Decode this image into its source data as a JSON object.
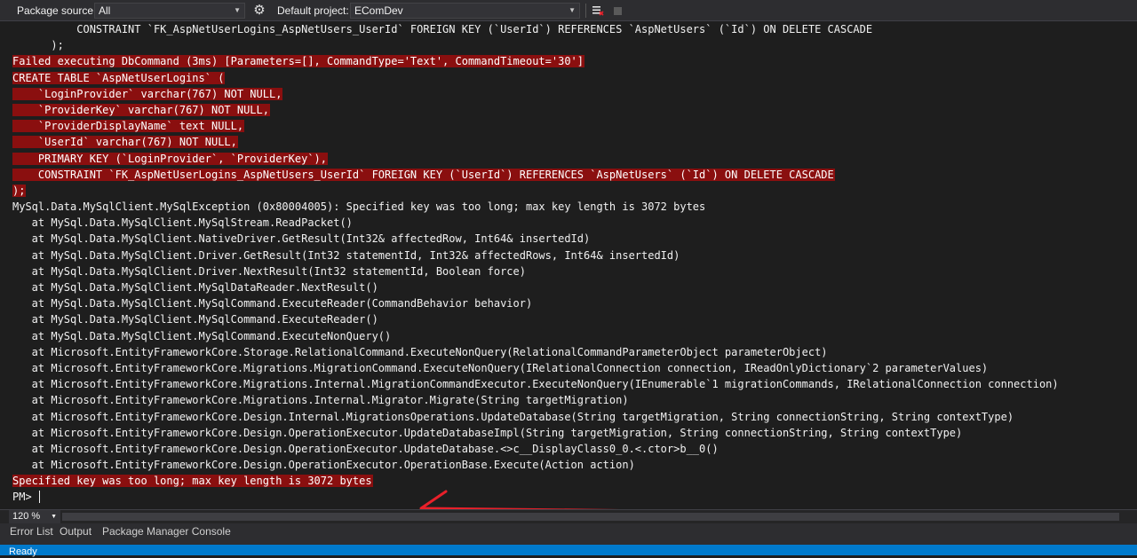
{
  "toolbar": {
    "package_source_label": "Package source:",
    "package_source_value": "All",
    "default_project_label": "Default project:",
    "default_project_value": "EComDev"
  },
  "console": {
    "lines": [
      {
        "text": "          CONSTRAINT `FK_AspNetUserLogins_AspNetUsers_UserId` FOREIGN KEY (`UserId`) REFERENCES `AspNetUsers` (`Id`) ON DELETE CASCADE",
        "error": false
      },
      {
        "text": "      );",
        "error": false
      },
      {
        "text": "Failed executing DbCommand (3ms) [Parameters=[], CommandType='Text', CommandTimeout='30']",
        "error": true
      },
      {
        "text": "CREATE TABLE `AspNetUserLogins` (",
        "error": true
      },
      {
        "text": "    `LoginProvider` varchar(767) NOT NULL,",
        "error": true
      },
      {
        "text": "    `ProviderKey` varchar(767) NOT NULL,",
        "error": true
      },
      {
        "text": "    `ProviderDisplayName` text NULL,",
        "error": true
      },
      {
        "text": "    `UserId` varchar(767) NOT NULL,",
        "error": true
      },
      {
        "text": "    PRIMARY KEY (`LoginProvider`, `ProviderKey`),",
        "error": true
      },
      {
        "text": "    CONSTRAINT `FK_AspNetUserLogins_AspNetUsers_UserId` FOREIGN KEY (`UserId`) REFERENCES `AspNetUsers` (`Id`) ON DELETE CASCADE",
        "error": true
      },
      {
        "text": ");",
        "error": true
      },
      {
        "text": "MySql.Data.MySqlClient.MySqlException (0x80004005): Specified key was too long; max key length is 3072 bytes",
        "error": false
      },
      {
        "text": "   at MySql.Data.MySqlClient.MySqlStream.ReadPacket()",
        "error": false
      },
      {
        "text": "   at MySql.Data.MySqlClient.NativeDriver.GetResult(Int32& affectedRow, Int64& insertedId)",
        "error": false
      },
      {
        "text": "   at MySql.Data.MySqlClient.Driver.GetResult(Int32 statementId, Int32& affectedRows, Int64& insertedId)",
        "error": false
      },
      {
        "text": "   at MySql.Data.MySqlClient.Driver.NextResult(Int32 statementId, Boolean force)",
        "error": false
      },
      {
        "text": "   at MySql.Data.MySqlClient.MySqlDataReader.NextResult()",
        "error": false
      },
      {
        "text": "   at MySql.Data.MySqlClient.MySqlCommand.ExecuteReader(CommandBehavior behavior)",
        "error": false
      },
      {
        "text": "   at MySql.Data.MySqlClient.MySqlCommand.ExecuteReader()",
        "error": false
      },
      {
        "text": "   at MySql.Data.MySqlClient.MySqlCommand.ExecuteNonQuery()",
        "error": false
      },
      {
        "text": "   at Microsoft.EntityFrameworkCore.Storage.RelationalCommand.ExecuteNonQuery(RelationalCommandParameterObject parameterObject)",
        "error": false
      },
      {
        "text": "   at Microsoft.EntityFrameworkCore.Migrations.MigrationCommand.ExecuteNonQuery(IRelationalConnection connection, IReadOnlyDictionary`2 parameterValues)",
        "error": false
      },
      {
        "text": "   at Microsoft.EntityFrameworkCore.Migrations.Internal.MigrationCommandExecutor.ExecuteNonQuery(IEnumerable`1 migrationCommands, IRelationalConnection connection)",
        "error": false
      },
      {
        "text": "   at Microsoft.EntityFrameworkCore.Migrations.Internal.Migrator.Migrate(String targetMigration)",
        "error": false
      },
      {
        "text": "   at Microsoft.EntityFrameworkCore.Design.Internal.MigrationsOperations.UpdateDatabase(String targetMigration, String connectionString, String contextType)",
        "error": false
      },
      {
        "text": "   at Microsoft.EntityFrameworkCore.Design.OperationExecutor.UpdateDatabaseImpl(String targetMigration, String connectionString, String contextType)",
        "error": false
      },
      {
        "text": "   at Microsoft.EntityFrameworkCore.Design.OperationExecutor.UpdateDatabase.<>c__DisplayClass0_0.<.ctor>b__0()",
        "error": false
      },
      {
        "text": "   at Microsoft.EntityFrameworkCore.Design.OperationExecutor.OperationBase.Execute(Action action)",
        "error": false
      },
      {
        "text": "Specified key was too long; max key length is 3072 bytes",
        "error": true
      },
      {
        "text": "PM> ",
        "error": false
      }
    ]
  },
  "zoom": {
    "value": "120 %"
  },
  "bottom_tabs": [
    "Error List",
    "Output",
    "Package Manager Console"
  ],
  "status": {
    "text": "Ready"
  },
  "colors": {
    "error_bg": "#8a0f0f",
    "status_bar": "#007acc",
    "arrow": "#e8202a"
  },
  "icons": {
    "settings": "gear-icon",
    "clear": "clear-console-icon",
    "stop": "stop-icon"
  }
}
